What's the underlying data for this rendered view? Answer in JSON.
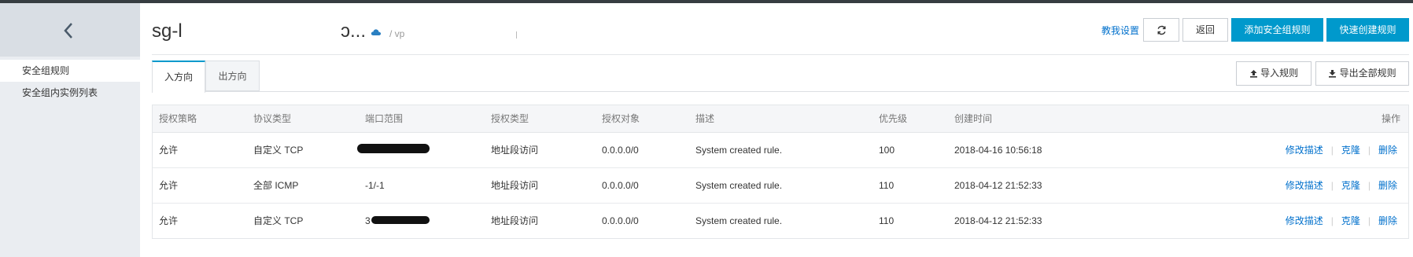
{
  "sidebar": {
    "items": [
      {
        "label": "安全组规则",
        "active": true
      },
      {
        "label": "安全组内实例列表",
        "active": false
      }
    ]
  },
  "header": {
    "sg_id_prefix": "sg-l",
    "sg_id_suffix": "ɔ...",
    "vpc_label": "/ vp",
    "help_link": "教我设置",
    "back_label": "返回",
    "add_rule_label": "添加安全组规则",
    "quick_create_label": "快速创建规则"
  },
  "tabs": [
    {
      "label": "入方向",
      "active": true
    },
    {
      "label": "出方向",
      "active": false
    }
  ],
  "toolbar": {
    "import_label": "导入规则",
    "export_label": "导出全部规则"
  },
  "table": {
    "columns": [
      "授权策略",
      "协议类型",
      "端口范围",
      "授权类型",
      "授权对象",
      "描述",
      "优先级",
      "创建时间",
      "操作"
    ],
    "rows": [
      {
        "policy": "允许",
        "protocol": "自定义 TCP",
        "port": "",
        "auth_type": "地址段访问",
        "target": "0.0.0.0/0",
        "desc": "System created rule.",
        "priority": "100",
        "created": "2018-04-16 10:56:18"
      },
      {
        "policy": "允许",
        "protocol": "全部 ICMP",
        "port": "-1/-1",
        "auth_type": "地址段访问",
        "target": "0.0.0.0/0",
        "desc": "System created rule.",
        "priority": "110",
        "created": "2018-04-12 21:52:33"
      },
      {
        "policy": "允许",
        "protocol": "自定义 TCP",
        "port": "3",
        "auth_type": "地址段访问",
        "target": "0.0.0.0/0",
        "desc": "System created rule.",
        "priority": "110",
        "created": "2018-04-12 21:52:33"
      }
    ],
    "actions": {
      "edit": "修改描述",
      "clone": "克隆",
      "delete": "删除"
    }
  },
  "colors": {
    "primary": "#0099cc",
    "link": "#0070cc",
    "sidebar_bg": "#eaedf1",
    "topbar": "#373d41"
  },
  "icons": [
    "chevron-left-icon",
    "cloud-icon",
    "refresh-icon",
    "upload-icon",
    "download-icon"
  ]
}
